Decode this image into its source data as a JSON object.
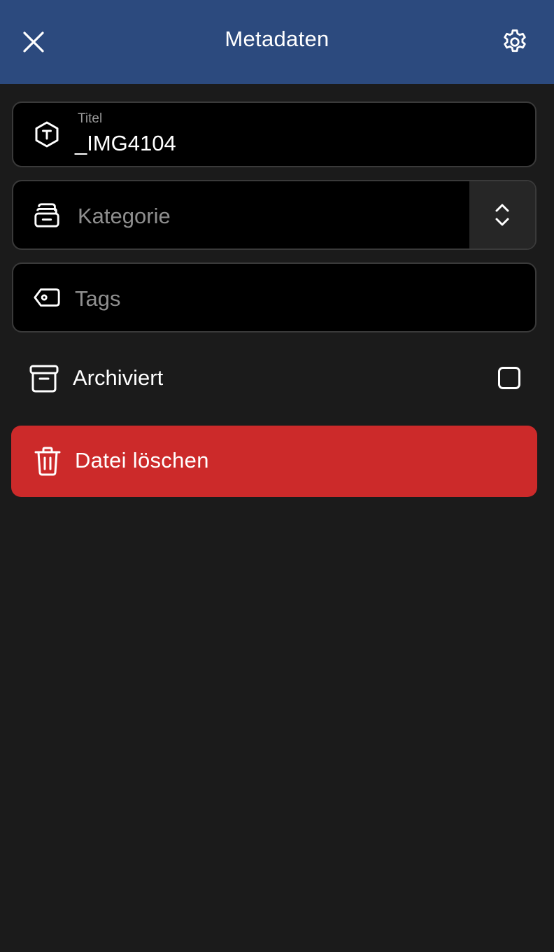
{
  "header": {
    "title": "Metadaten",
    "close_icon": "close-icon",
    "settings_icon": "gear-icon",
    "background": "#2c4a7e"
  },
  "fields": {
    "title": {
      "label": "Titel",
      "value": "_IMG4104",
      "icon": "title-hexagon-icon"
    },
    "category": {
      "placeholder": "Kategorie",
      "icon": "category-stack-icon",
      "stepper_icon": "chevron-up-down-icon"
    },
    "tags": {
      "placeholder": "Tags",
      "icon": "tag-icon"
    }
  },
  "archive": {
    "label": "Archiviert",
    "icon": "archive-box-icon",
    "checked": false
  },
  "delete": {
    "label": "Datei löschen",
    "icon": "trash-icon",
    "color": "#cc2a2a"
  }
}
